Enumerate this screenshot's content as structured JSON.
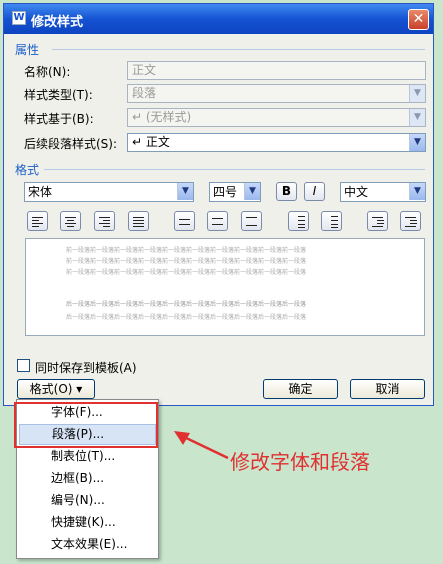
{
  "window": {
    "title": "修改样式",
    "close_symbol": "✕",
    "icon_symbol": "W"
  },
  "properties": {
    "section_label": "属性",
    "name": {
      "label": "名称(N):",
      "value": "正文"
    },
    "style_type": {
      "label": "样式类型(T):",
      "value": "段落"
    },
    "based_on": {
      "label": "样式基于(B):",
      "value": "↵ (无样式)"
    },
    "next_style": {
      "label": "后续段落样式(S):",
      "value": "↵ 正文"
    }
  },
  "format": {
    "section_label": "格式",
    "font": "宋体",
    "size": "四号",
    "bold": "B",
    "italic": "I",
    "language": "中文"
  },
  "preview": {
    "prev_line": "前一段落前一段落前一段落前一段落前一段落前一段落前一段落前一段落前一段落前一段落",
    "next_line": "后一段落后一段落后一段落后一段落后一段落后一段落后一段落后一段落后一段落后一段落"
  },
  "options": {
    "save_to_template": "同时保存到模板(A)"
  },
  "buttons": {
    "format_menu": "格式(O) ▾",
    "ok": "确定",
    "cancel": "取消"
  },
  "format_menu_items": [
    {
      "label": "字体(F)..."
    },
    {
      "label": "段落(P)..."
    },
    {
      "label": "制表位(T)..."
    },
    {
      "label": "边框(B)..."
    },
    {
      "label": "编号(N)..."
    },
    {
      "label": "快捷键(K)..."
    },
    {
      "label": "文本效果(E)..."
    }
  ],
  "annotation": {
    "text": "修改字体和段落"
  },
  "colors": {
    "highlight": "#e03030",
    "title_bar": "#1553d2",
    "section": "#1c5fc8"
  }
}
